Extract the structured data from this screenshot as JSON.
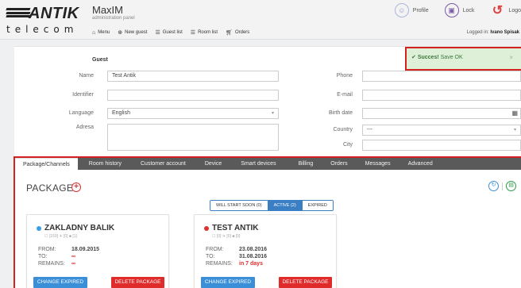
{
  "brand": {
    "logo_text": "ANTIK",
    "logo_sub": "telecom"
  },
  "app": {
    "title": "MaxIM",
    "subtitle": "administration panel"
  },
  "topnav": [
    {
      "icon": "home-icon",
      "label": "Menu"
    },
    {
      "icon": "plus-circle-icon",
      "label": "New guest"
    },
    {
      "icon": "list-icon",
      "label": "Guest list"
    },
    {
      "icon": "list-icon",
      "label": "Room list"
    },
    {
      "icon": "cart-icon",
      "label": "Orders"
    }
  ],
  "header_actions": {
    "profile": "Profile",
    "lock": "Lock",
    "logout": "Logo"
  },
  "logged_in": {
    "prefix": "Logged in:",
    "user": "Ivano Spisak"
  },
  "alert": {
    "strong": "Succes!",
    "text": "Save OK",
    "close": "×"
  },
  "guest": {
    "title": "Guest",
    "name_label": "Name",
    "name_value": "Test Antik",
    "identifier_label": "Identifier",
    "identifier_value": "",
    "language_label": "Language",
    "language_value": "English",
    "address_label": "Adresa",
    "address_value": "",
    "phone_label": "Phone",
    "phone_value": "",
    "email_label": "E-mail",
    "email_value": "",
    "birth_label": "Birth date",
    "birth_value": "",
    "country_label": "Country",
    "country_value": "---",
    "city_label": "City",
    "city_value": ""
  },
  "tabs": [
    "Package/Channels",
    "Room history",
    "Customer account",
    "Device",
    "Smart devices",
    "Billing",
    "Orders",
    "Messages",
    "Advanced"
  ],
  "package": {
    "title": "PACKAGE",
    "filters": [
      "WILL START SOON (0)",
      "ACTIVE (2)",
      "EXPIRED"
    ],
    "cards": [
      {
        "name": "ZAKLADNY BALIK",
        "dot_color": "#3aa0e0",
        "meta": "☐ [159]  ✈ [0]  ■ [1]",
        "from_label": "FROM:",
        "from": "18.09.2015",
        "to_label": "TO:",
        "to": "∞",
        "remains_label": "REMAINS:",
        "remains": "∞",
        "btn_left": "CHANGE EXPIRED",
        "btn_right": "DELETE PACKAGE"
      },
      {
        "name": "TEST ANTIK",
        "dot_color": "#e03030",
        "meta": "☐ [0]  ✈ [0]  ■ [0]",
        "from_label": "FROM:",
        "from": "23.08.2016",
        "to_label": "TO:",
        "to": "31.08.2016",
        "remains_label": "REMAINS:",
        "remains": "in 7 days",
        "btn_left": "CHANGE EXPIRED",
        "btn_right": "DELETE PACKAGE"
      }
    ]
  },
  "colors": {
    "accent_red": "#e02b2b",
    "accent_blue": "#3b8fd9",
    "tab_bar": "#5a5a5a",
    "highlight_border": "#d32020"
  }
}
